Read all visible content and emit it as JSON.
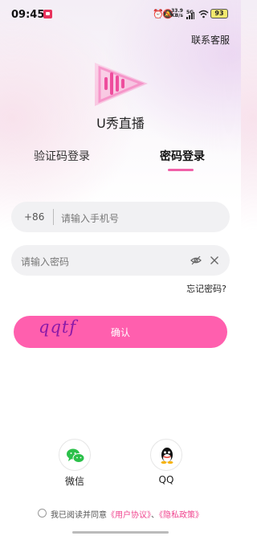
{
  "status_bar": {
    "time": "09:45",
    "net_speed_value": "33.9",
    "net_speed_unit": "KB/s",
    "network_type": "5G",
    "battery_level": "93"
  },
  "header": {
    "contact_service": "联系客服"
  },
  "app": {
    "name": "U秀直播"
  },
  "tabs": [
    {
      "label": "验证码登录",
      "active": false
    },
    {
      "label": "密码登录",
      "active": true
    }
  ],
  "form": {
    "country_code": "+86",
    "phone_placeholder": "请输入手机号",
    "password_placeholder": "请输入密码",
    "forgot_password": "忘记密码?",
    "confirm_label": "确认",
    "handwritten_note": "qqtf"
  },
  "social": [
    {
      "label": "微信",
      "icon": "wechat-icon"
    },
    {
      "label": "QQ",
      "icon": "qq-icon"
    }
  ],
  "agreement": {
    "prefix": "我已阅读并同意",
    "user_agreement": "《用户协议》",
    "separator": "、",
    "privacy_policy": "《隐私政策》"
  },
  "colors": {
    "accent": "#ff5fae",
    "link": "#f0438e",
    "tab_underline": "#f060a8",
    "wechat_green": "#2bc04a"
  }
}
